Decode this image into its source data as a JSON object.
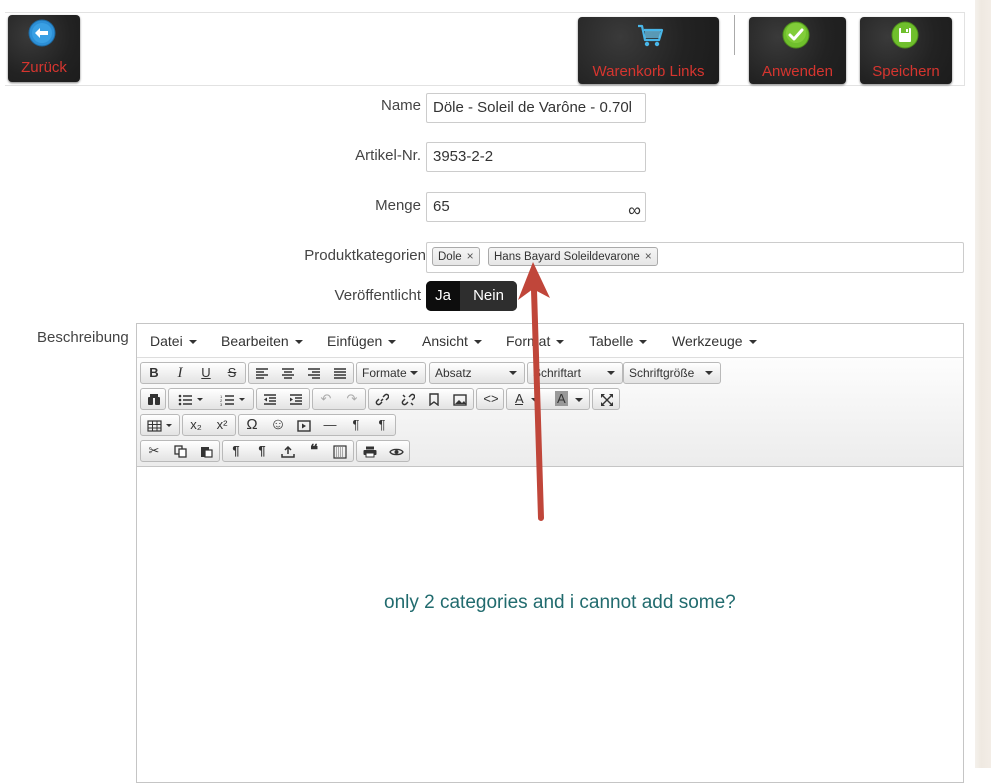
{
  "header": {
    "back_label": "Zurück",
    "cart_label": "Warenkorb Links",
    "apply_label": "Anwenden",
    "save_label": "Speichern"
  },
  "form": {
    "name_label": "Name",
    "name_value": "Döle - Soleil de Varône - 0.70l",
    "sku_label": "Artikel-Nr.",
    "sku_value": "3953-2-2",
    "qty_label": "Menge",
    "qty_value": "65",
    "qty_suffix": "∞",
    "categories_label": "Produktkategorien",
    "categories": [
      "Dole",
      "Hans Bayard Soleildevarone"
    ],
    "tag_remove": "×",
    "published_label": "Veröffentlicht",
    "published_yes": "Ja",
    "published_no": "Nein",
    "description_label": "Beschreibung"
  },
  "editor": {
    "menu": [
      "Datei",
      "Bearbeiten",
      "Einfügen",
      "Ansicht",
      "Format",
      "Tabelle",
      "Werkzeuge"
    ],
    "dropdowns": [
      "Formate",
      "Absatz",
      "Schriftart",
      "Schriftgröße"
    ],
    "buttons": {
      "bold": "B",
      "italic": "I",
      "underline": "U",
      "strike": "S",
      "subscript": "x₂",
      "superscript": "x²",
      "omega": "Ω",
      "smiley": "☺",
      "hr": "—",
      "ltr": "¶",
      "rtl": "¶",
      "paragraph": "¶",
      "blockquote": "❝",
      "textcolor": "A",
      "bgcolor": "A"
    }
  },
  "annotation": {
    "text": "only 2 categories and i cannot add some?",
    "arrow_color": "#c0463a"
  },
  "colors": {
    "accent_red": "#d6352f",
    "annotation_text": "#216b6e"
  }
}
